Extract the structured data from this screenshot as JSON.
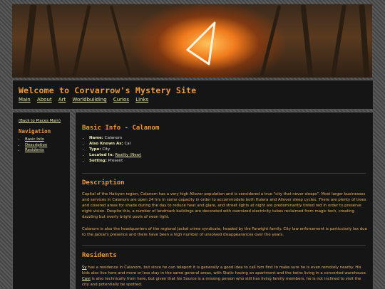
{
  "header": {
    "title": "Welcome to Corvarrow's Mystery Site",
    "nav": [
      "Main",
      "About",
      "Art",
      "Worldbuilding",
      "Curios",
      "Links"
    ]
  },
  "sidebar": {
    "back_link": "(Back to Places Main)",
    "heading": "Navigation",
    "items": [
      "Basic Info",
      "Description",
      "Residents"
    ]
  },
  "main": {
    "basic_info": {
      "heading": "Basic Info - Calanom",
      "fields": [
        {
          "label": "Name:",
          "value": "Calanom"
        },
        {
          "label": "Also Known As:",
          "value": "Cal"
        },
        {
          "label": "Type:",
          "value": "City"
        },
        {
          "label": "Located In:",
          "value": "Reality (New)"
        },
        {
          "label": "Setting:",
          "value": "Present"
        }
      ]
    },
    "description": {
      "heading": "Description",
      "p1": "Capital of the Halcyon region, Calanom has a very high Allover population and is considered a true \"city that never sleeps\". Most larger businesses and services in Calanom are open 24 hrs in some capacity in order to accommodate both Hulera and Allover sleep cycles. There are plenty of trees and covered areas for shade during the day to reduce heat and glare, and street lights at night are predominantly tinted red in order to preserve night vision. Despite this, a number of landmark buildings are decorated with oversized electricity tubes reclaimed from magic tech, creating dazzling but overly bright pools of neon light.",
      "p2": "Calanom is also the headquarters of the regional Jackal crime syndicate, headed by the Farwight family. City law enforcement is particularly lax due to the Jackal's presence and there have been a high number of unsolved disappearances over the years."
    },
    "residents": {
      "heading": "Residents",
      "link1": "Sy",
      "text1": " has a residence in Calanom, but since he can teleport it is generally a good idea to call him first to make sure he is even remotely nearby. His kids also live here and more or less stay in the same general areas, with Static having an apartment and the twins living in a converted warehouse. ",
      "link2": "Cavi",
      "text2": " is also technically from here, but given that his Source is a missing person who still has living family members, he is not inclined to visit the city and potentially be spotted."
    }
  },
  "colors": {
    "accent": "#e89a3c",
    "link": "#e8e8b0",
    "panel": "#151515"
  }
}
